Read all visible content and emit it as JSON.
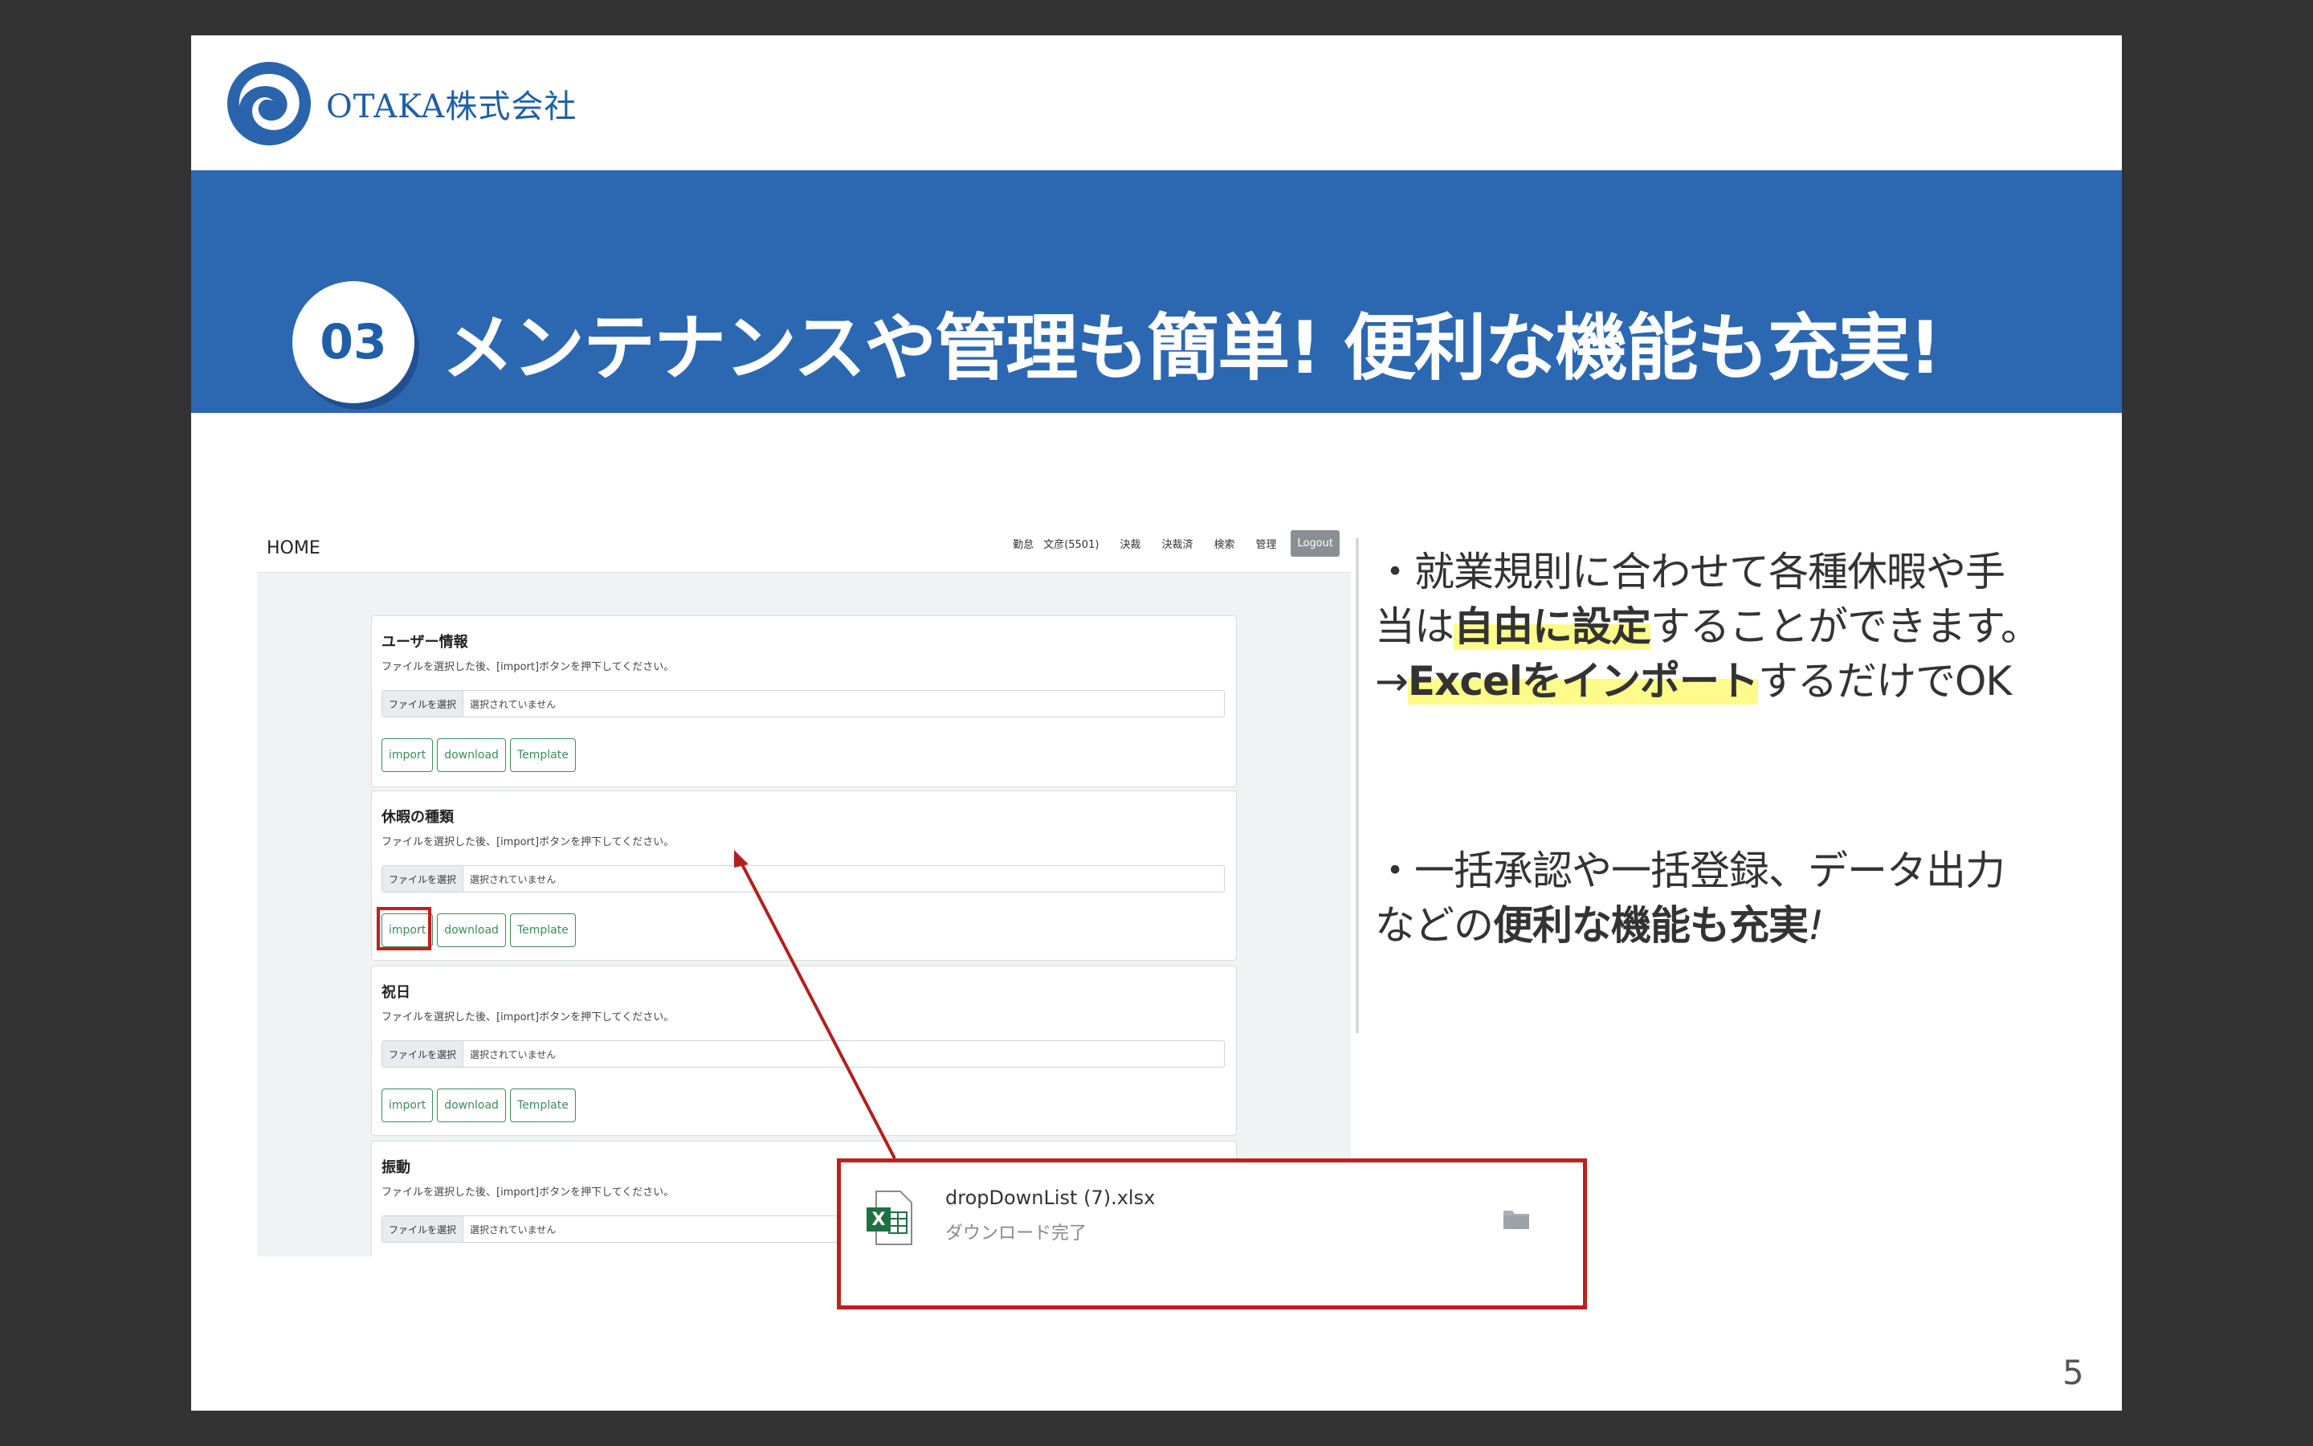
{
  "logo": {
    "text": "OTAKA株式会社"
  },
  "banner": {
    "number": "03",
    "title": "メンテナンスや管理も簡単! 便利な機能も充実!"
  },
  "screenshot": {
    "home": "HOME",
    "menu": [
      "勤怠",
      "文彦(5501)",
      "決裁",
      "決裁済",
      "検索",
      "管理"
    ],
    "logout": "Logout",
    "cards": [
      {
        "title": "ユーザー情報",
        "desc": "ファイルを選択した後、[import]ボタンを押下してください。",
        "file_button": "ファイルを選択",
        "file_value": "選択されていません",
        "buttons": [
          "import",
          "download",
          "Template"
        ]
      },
      {
        "title": "休暇の種類",
        "desc": "ファイルを選択した後、[import]ボタンを押下してください。",
        "file_button": "ファイルを選択",
        "file_value": "選択されていません",
        "buttons": [
          "import",
          "download",
          "Template"
        ]
      },
      {
        "title": "祝日",
        "desc": "ファイルを選択した後、[import]ボタンを押下してください。",
        "file_button": "ファイルを選択",
        "file_value": "選択されていません",
        "buttons": [
          "import",
          "download",
          "Template"
        ]
      },
      {
        "title": "振動",
        "desc": "ファイルを選択した後、[import]ボタンを押下してください。",
        "file_button": "ファイルを選択",
        "file_value": "選択されていません",
        "buttons": []
      }
    ]
  },
  "bullets": {
    "b1_line1": "・就業規則に合わせて各種休暇や手",
    "b1_line2_pre": "当は",
    "b1_line2_bold": "自由に設定",
    "b1_line2_post": "することができます。",
    "b1_line3_pre": "→",
    "b1_line3_bold": "Excelをインポート",
    "b1_line3_post": "するだけでOK",
    "b2_line1": "・一括承認や一括登録、データ出力",
    "b2_line2_pre": "などの",
    "b2_line2_bold": "便利な機能も充実",
    "b2_line2_post": "!"
  },
  "download": {
    "filename": "dropDownList (7).xlsx",
    "status": "ダウンロード完了"
  },
  "page_number": "5",
  "colors": {
    "banner": "#2c67b2",
    "accent_red": "#c0201d",
    "highlight": "#fdfb8a",
    "button_green": "#3d8b5a"
  }
}
